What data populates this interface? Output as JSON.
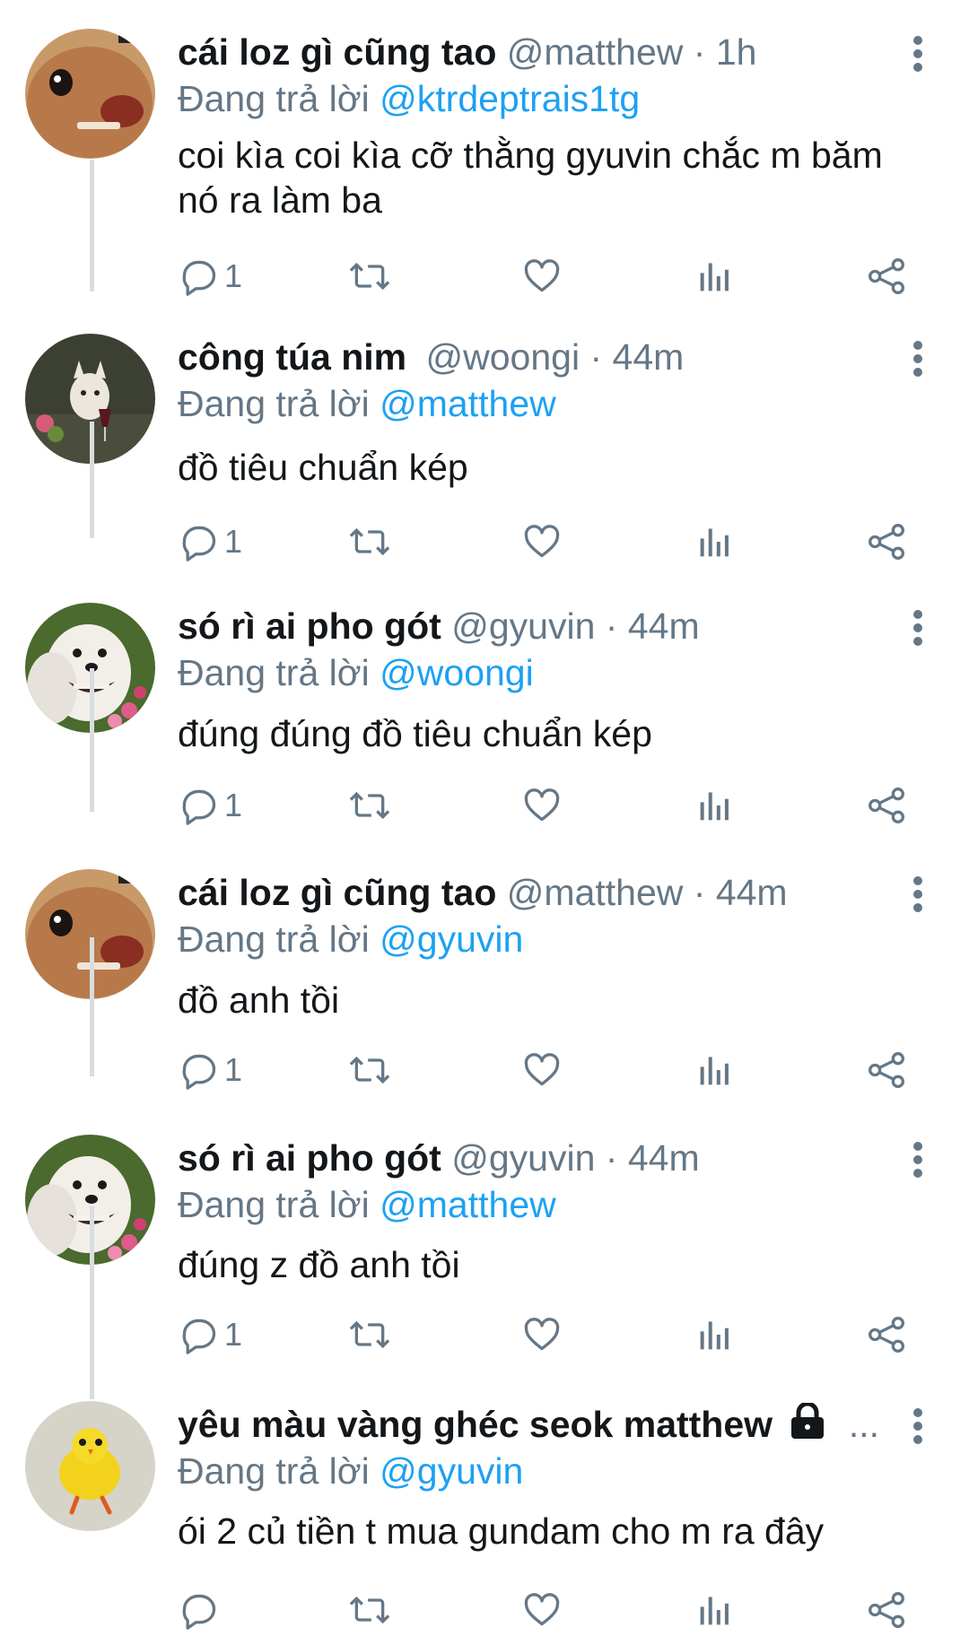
{
  "reply_prefix": "Đang trả lời",
  "tweets": [
    {
      "name": "cái loz gì cũng tao",
      "handle": "@matthew",
      "time": "1h",
      "reply_to": "@ktrdeptrais1tg",
      "text": "coi kìa coi kìa cỡ thằng gyuvin chắc m băm nó ra làm ba",
      "reply_count": "1",
      "avatar": "dog-closeup"
    },
    {
      "name": "công túa nim",
      "handle": "@woongi",
      "time": "44m",
      "reply_to": "@matthew",
      "text": "đồ tiêu chuẩn kép",
      "reply_count": "1",
      "avatar": "dog-wine"
    },
    {
      "name": "só rì ai pho gót",
      "handle": "@gyuvin",
      "time": "44m",
      "reply_to": "@woongi",
      "text": "đúng đúng đồ tiêu chuẩn kép",
      "reply_count": "1",
      "avatar": "dog-smile"
    },
    {
      "name": "cái loz gì cũng tao",
      "handle": "@matthew",
      "time": "44m",
      "reply_to": "@gyuvin",
      "text": "đồ anh tồi",
      "reply_count": "1",
      "avatar": "dog-closeup"
    },
    {
      "name": "só rì ai pho gót",
      "handle": "@gyuvin",
      "time": "44m",
      "reply_to": "@matthew",
      "text": "đúng z đồ anh tồi",
      "reply_count": "1",
      "avatar": "dog-smile"
    },
    {
      "name": "yêu màu vàng ghéc seok matthew",
      "handle": "",
      "time": "",
      "ellipsis": "...",
      "locked": true,
      "reply_to": "@gyuvin",
      "text": "ói 2 củ tiền t mua gundam cho m ra đây",
      "reply_count": "",
      "avatar": "yellow-chick"
    }
  ],
  "colors": {
    "link": "#1da1f2",
    "muted": "#657786",
    "thread_line": "#d9dde1"
  }
}
